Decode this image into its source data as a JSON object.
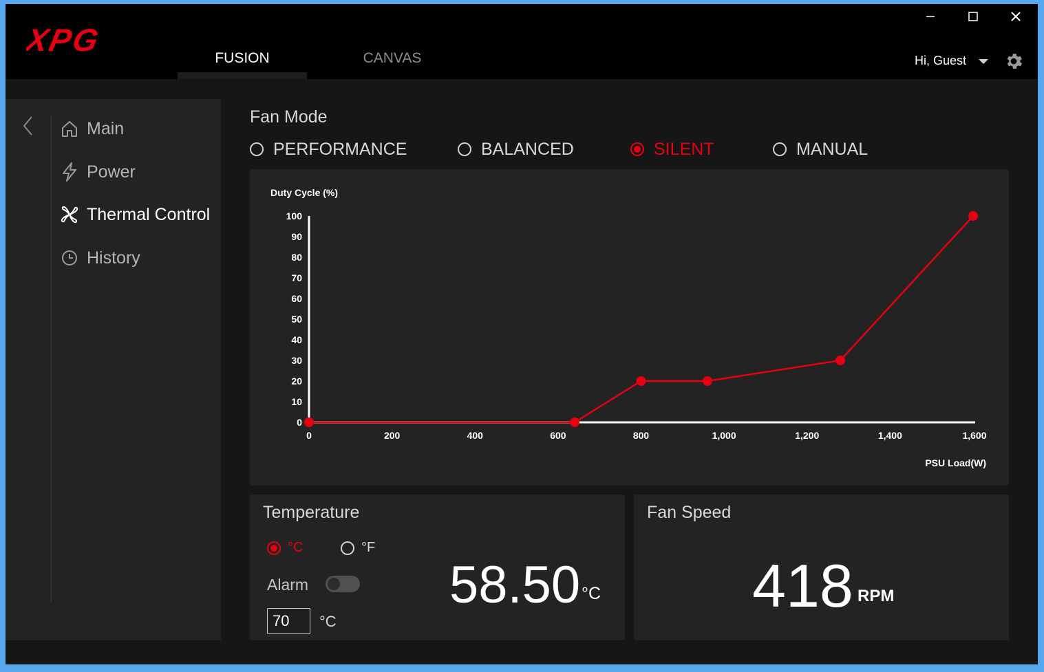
{
  "app": {
    "logo_text": "XPG",
    "tabs": [
      {
        "label": "FUSION",
        "active": true
      },
      {
        "label": "CANVAS",
        "active": false
      }
    ],
    "user_greeting": "Hi, Guest"
  },
  "sidebar": {
    "items": [
      {
        "label": "Main",
        "icon": "home-icon",
        "active": false
      },
      {
        "label": "Power",
        "icon": "lightning-icon",
        "active": false
      },
      {
        "label": "Thermal Control",
        "icon": "fan-icon",
        "active": true
      },
      {
        "label": "History",
        "icon": "clock-icon",
        "active": false
      }
    ]
  },
  "fan_mode": {
    "title": "Fan Mode",
    "options": [
      "PERFORMANCE",
      "BALANCED",
      "SILENT",
      "MANUAL"
    ],
    "selected": "SILENT"
  },
  "chart_data": {
    "type": "line",
    "ylabel": "Duty Cycle (%)",
    "xlabel": "PSU Load(W)",
    "xlim": [
      0,
      1600
    ],
    "ylim": [
      0,
      100
    ],
    "x_ticks": [
      "0",
      "200",
      "400",
      "600",
      "800",
      "1,000",
      "1,200",
      "1,400",
      "1,600"
    ],
    "y_ticks": [
      "0",
      "10",
      "20",
      "30",
      "40",
      "50",
      "60",
      "70",
      "80",
      "90",
      "100"
    ],
    "series": [
      {
        "points": [
          [
            0,
            0
          ],
          [
            640,
            0
          ],
          [
            800,
            20
          ],
          [
            960,
            20
          ],
          [
            1280,
            30
          ],
          [
            1600,
            100
          ]
        ],
        "color": "#e60012"
      }
    ],
    "grid": false
  },
  "temperature": {
    "title": "Temperature",
    "units": [
      "°C",
      "°F"
    ],
    "selected_unit": "°C",
    "alarm_label": "Alarm",
    "alarm_enabled": false,
    "alarm_value": "70",
    "alarm_unit": "°C",
    "value": "58.50",
    "value_unit": "°C"
  },
  "fan_speed": {
    "title": "Fan Speed",
    "value": "418",
    "unit": "RPM"
  },
  "colors": {
    "accent": "#e60012",
    "background": "#161616",
    "panel": "#232323"
  }
}
